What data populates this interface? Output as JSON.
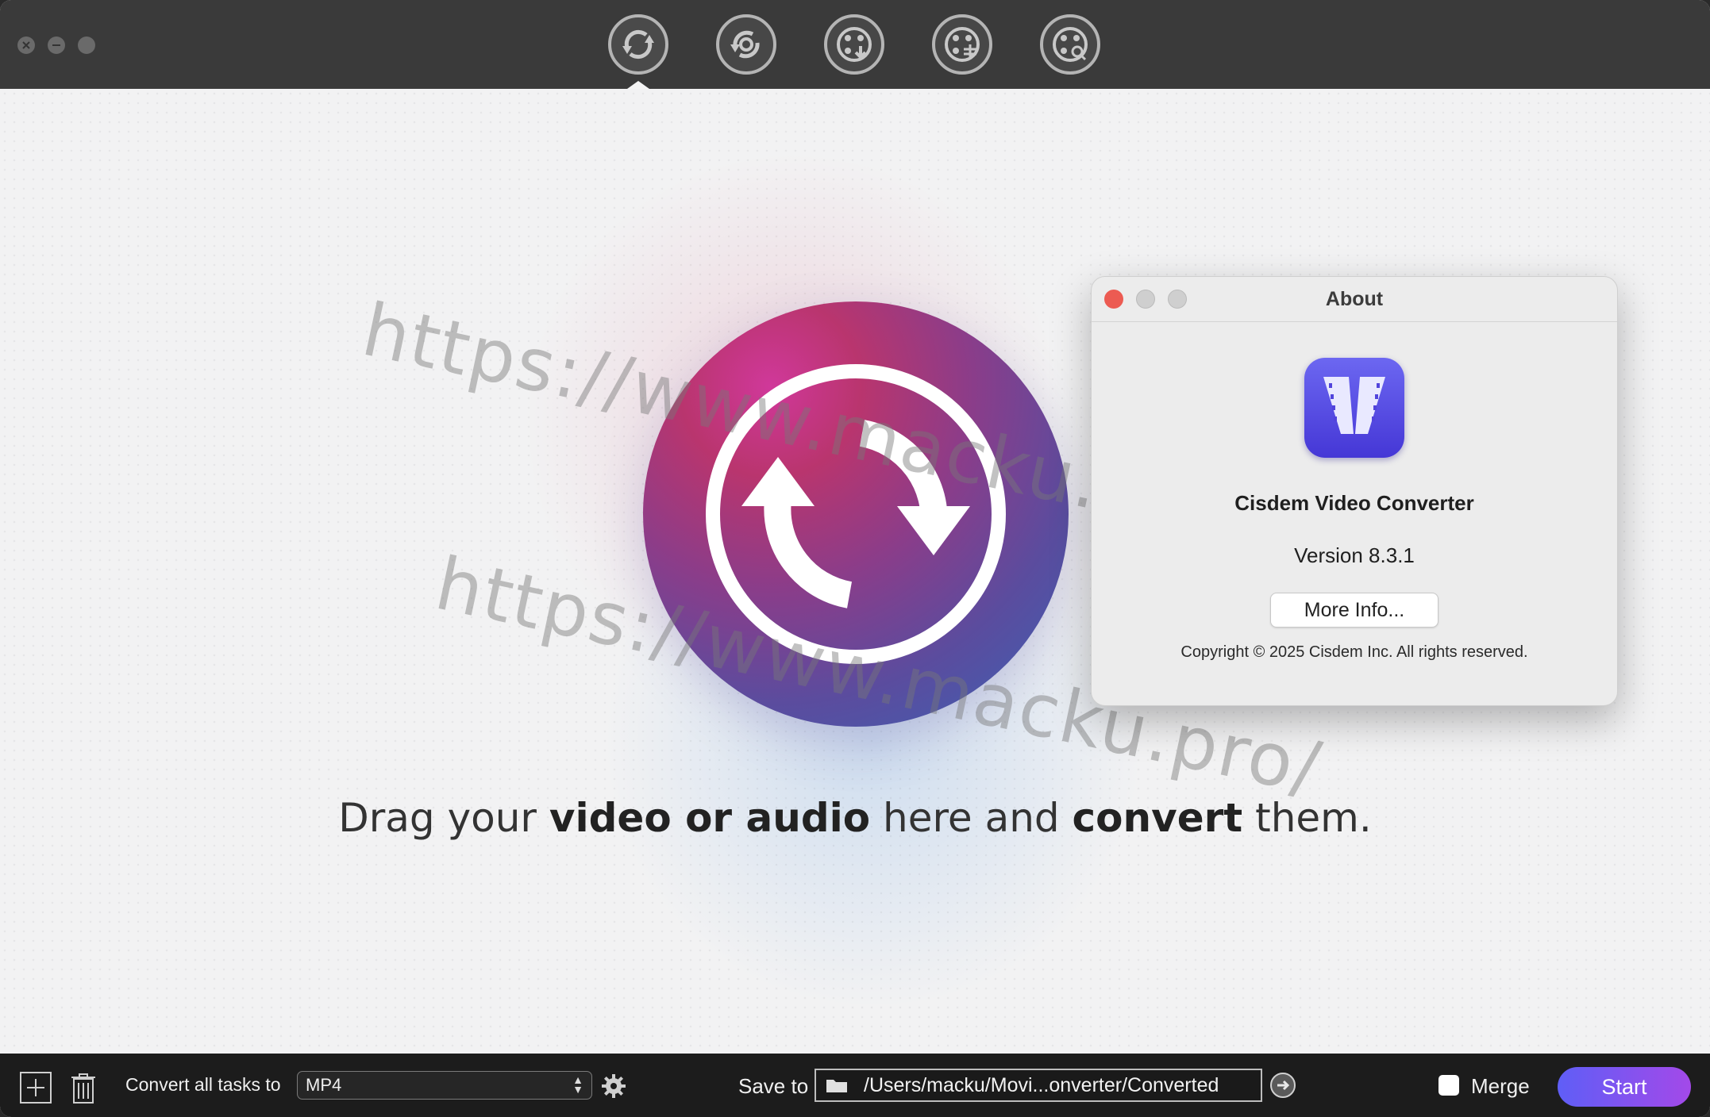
{
  "toolbar": {
    "buttons": [
      {
        "icon": "convert-icon",
        "active": true
      },
      {
        "icon": "rip-disc-icon",
        "active": false
      },
      {
        "icon": "download-video-icon",
        "active": false
      },
      {
        "icon": "edit-video-icon",
        "active": false
      },
      {
        "icon": "video-info-icon",
        "active": false
      }
    ]
  },
  "main": {
    "watermark_text": "https://www.macku.pro/",
    "drop_hint": {
      "part1": "Drag your ",
      "bold1": "video or audio",
      "part2": " here and ",
      "bold2": "convert",
      "part3": " them."
    }
  },
  "about_dialog": {
    "title": "About",
    "app_name": "Cisdem Video Converter",
    "version": "Version 8.3.1",
    "more_info_label": "More Info...",
    "copyright": "Copyright © 2025 Cisdem Inc. All rights reserved."
  },
  "bottom_bar": {
    "convert_label": "Convert all tasks to",
    "format_value": "MP4",
    "save_to_label": "Save to",
    "save_path": "/Users/macku/Movi...onverter/Converted",
    "merge_label": "Merge",
    "merge_checked": false,
    "start_label": "Start"
  },
  "colors": {
    "titlebar": "#3a3a3a",
    "bottombar": "#1c1c1c",
    "start_gradient_from": "#5f5ef6",
    "start_gradient_to": "#a349e9",
    "close_red": "#ec5b52"
  }
}
